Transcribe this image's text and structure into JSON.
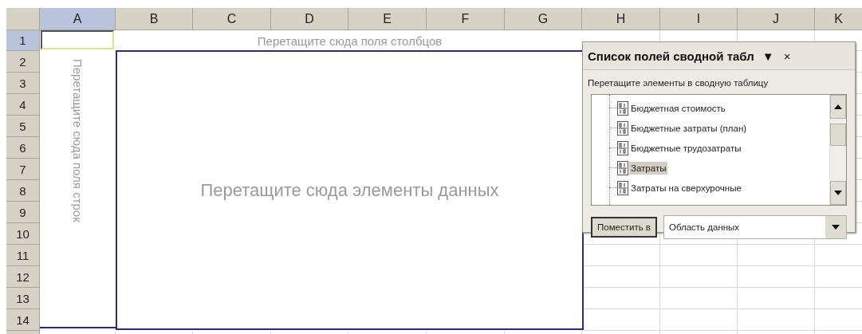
{
  "sheet": {
    "columns": [
      {
        "label": "A",
        "selected": true
      },
      {
        "label": "B",
        "selected": false
      },
      {
        "label": "C",
        "selected": false
      },
      {
        "label": "D",
        "selected": false
      },
      {
        "label": "E",
        "selected": false
      },
      {
        "label": "F",
        "selected": false
      },
      {
        "label": "G",
        "selected": false
      },
      {
        "label": "H",
        "selected": false
      },
      {
        "label": "I",
        "selected": false
      },
      {
        "label": "J",
        "selected": false
      },
      {
        "label": "K",
        "selected": false
      }
    ],
    "rows": [
      {
        "label": "1",
        "selected": true
      },
      {
        "label": "2",
        "selected": false
      },
      {
        "label": "3",
        "selected": false
      },
      {
        "label": "4",
        "selected": false
      },
      {
        "label": "5",
        "selected": false
      },
      {
        "label": "6",
        "selected": false
      },
      {
        "label": "7",
        "selected": false
      },
      {
        "label": "8",
        "selected": false
      },
      {
        "label": "9",
        "selected": false
      },
      {
        "label": "10",
        "selected": false
      },
      {
        "label": "11",
        "selected": false
      },
      {
        "label": "12",
        "selected": false
      },
      {
        "label": "13",
        "selected": false
      },
      {
        "label": "14",
        "selected": false
      }
    ]
  },
  "pivot": {
    "column_drop": "Перетащите сюда поля столбцов",
    "row_drop": "Перетащите сюда поля строк",
    "data_drop": "Перетащите сюда элементы данных"
  },
  "field_list": {
    "title": "Список полей сводной табл",
    "menu_glyph": "▼",
    "close_glyph": "×",
    "subtitle": "Перетащите элементы в сводную таблицу",
    "fields": [
      {
        "label": "Бюджетная стоимость",
        "selected": false
      },
      {
        "label": "Бюджетные затраты (план)",
        "selected": false
      },
      {
        "label": "Бюджетные трудозатраты",
        "selected": false
      },
      {
        "label": "Затраты",
        "selected": true
      },
      {
        "label": "Затраты на сверхурочные",
        "selected": false
      }
    ],
    "button": "Поместить в",
    "area_dropdown": {
      "value": "Область данных"
    }
  }
}
